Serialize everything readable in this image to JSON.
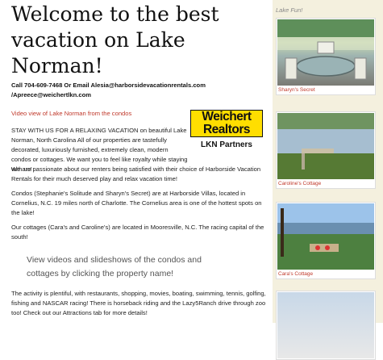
{
  "main": {
    "title": "Welcome to the best vacation on Lake Norman!",
    "contact_line1": "Call  704-609-7468   Or  Email Alesia@harborsidevacationrentals.com",
    "contact_line2": "/Apreece@weichertlkn.com",
    "video_link": "Video view of Lake Norman from the condos",
    "intro": "STAY WITH US FOR A RELAXING VACATION on beautiful Lake Norman, North Carolina   All of our properties are tastefully decorated, luxuriously furnished, extremely clean, modern condos or cottages. We want you to feel like royalty while staying with us!",
    "intro2": "We are passionate about our renters being satisfied with their choice of Harborside Vacation Rentals for their much deserved play and relax vacation time!",
    "condos": "Condos (Stephanie's Solitude and Sharyn's Secret) are at Harborside Villas, located in Cornelius, N.C. 19 miles north of Charlotte.  The Cornelius area is one of the hottest spots on the lake!",
    "cottages": "Our cottages (Cara's and Caroline's) are located in Mooresville, N.C.  The racing capital of the south!",
    "highlight": "View videos and slideshows of the condos and cottages by clicking the property name!",
    "activity": "The activity is plentiful, with restaurants, shopping, movies, boating, swimming, tennis, golfing, fishing and NASCAR racing!  There is horseback riding and the Lazy5Ranch drive through zoo too!  Check out our Attractions tab for more details!"
  },
  "logo": {
    "line1": "Weichert",
    "line2": "Realtors",
    "partners": "LKN Partners"
  },
  "sidebar": {
    "heading": "Lake Fun!",
    "items": [
      {
        "caption": "Sharyn's Secret"
      },
      {
        "caption": "Caroline's Cottage"
      },
      {
        "caption": "Cara's Cottage"
      },
      {
        "caption": ""
      }
    ]
  },
  "colors": {
    "link": "#c0392b",
    "sidebar_bg": "#f4f0de",
    "logo_yellow": "#ffde00"
  }
}
